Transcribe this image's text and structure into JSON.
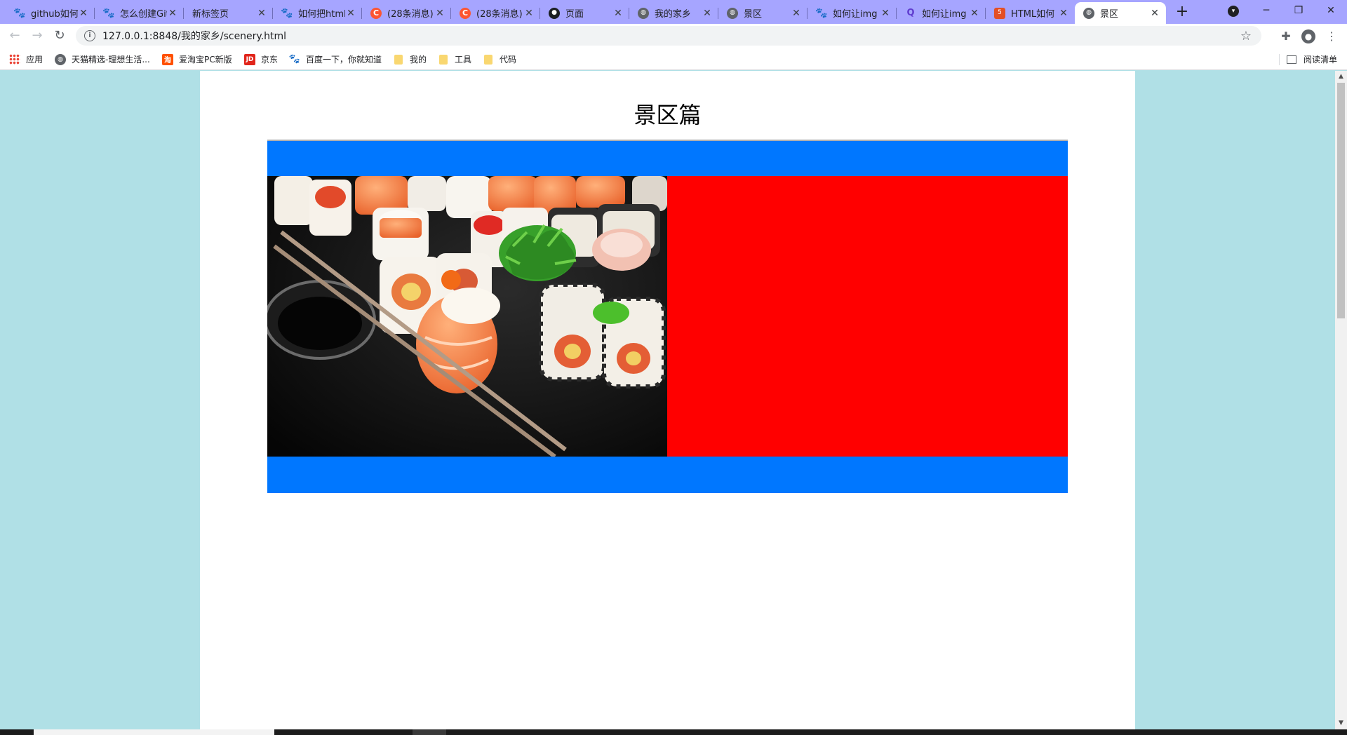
{
  "browser": {
    "tabs": [
      {
        "title": "github如何",
        "icon": "baidu-paw-icon"
      },
      {
        "title": "怎么创建Git",
        "icon": "baidu-paw-icon"
      },
      {
        "title": "新标签页",
        "icon": ""
      },
      {
        "title": "如何把html",
        "icon": "baidu-paw-icon"
      },
      {
        "title": "(28条消息)",
        "icon": "csdn-icon"
      },
      {
        "title": "(28条消息)",
        "icon": "csdn-icon"
      },
      {
        "title": "页面",
        "icon": "github-icon"
      },
      {
        "title": "我的家乡",
        "icon": "globe-icon"
      },
      {
        "title": "景区",
        "icon": "globe-icon"
      },
      {
        "title": "如何让img",
        "icon": "baidu-paw-icon"
      },
      {
        "title": "如何让img",
        "icon": "iqiyi-icon"
      },
      {
        "title": "HTML如何",
        "icon": "html5-icon"
      },
      {
        "title": "景区",
        "icon": "globe-icon",
        "active": true
      }
    ],
    "window_controls": {
      "minimize": "─",
      "restore": "❐",
      "close": "✕"
    },
    "new_tab": "+",
    "address": {
      "url": "127.0.0.1:8848/我的家乡/scenery.html"
    },
    "bookmarks": [
      {
        "label": "应用",
        "icon": "apps-grid-icon"
      },
      {
        "label": "天猫精选-理想生活...",
        "icon": "globe-icon"
      },
      {
        "label": "爱淘宝PC新版",
        "icon": "taobao-icon"
      },
      {
        "label": "京东",
        "icon": "jd-icon"
      },
      {
        "label": "百度一下，你就知道",
        "icon": "baidu-paw-icon"
      },
      {
        "label": "我的",
        "icon": "folder-icon"
      },
      {
        "label": "工具",
        "icon": "folder-icon"
      },
      {
        "label": "代码",
        "icon": "folder-icon"
      }
    ],
    "reading_list": "阅读清单"
  },
  "page": {
    "title": "景区篇",
    "colors": {
      "background": "#b0e0e6",
      "container": "#ffffff",
      "banner": "#0077ff",
      "right_panel": "#ff0000"
    },
    "left_panel_image": "sushi-platter-photo"
  }
}
